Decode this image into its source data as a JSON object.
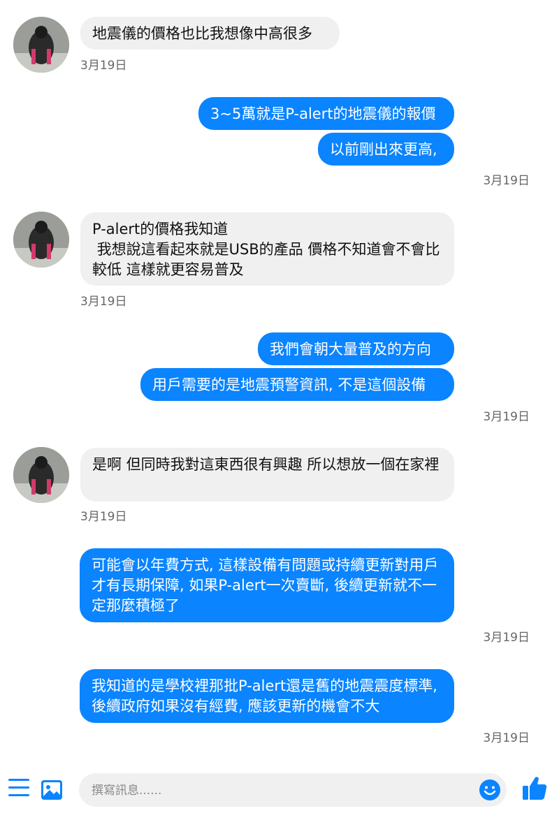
{
  "messages": [
    {
      "sender": "other",
      "text": "地震儀的價格也比我想像中高很多",
      "time": "3月19日"
    },
    {
      "sender": "me",
      "text": "3~5萬就是P-alert的地震儀的報價"
    },
    {
      "sender": "me",
      "text": "以前剛出來更高,",
      "time": "3月19日"
    },
    {
      "sender": "other",
      "text": "P-alert的價格我知道\n 我想說這看起來就是USB的產品 價格不知道會不會比較低 這樣就更容易普及",
      "time": "3月19日"
    },
    {
      "sender": "me",
      "text": "我們會朝大量普及的方向"
    },
    {
      "sender": "me",
      "text": "用戶需要的是地震預警資訊, 不是這個設備",
      "time": "3月19日"
    },
    {
      "sender": "other",
      "text": "是啊 但同時我對這東西很有興趣 所以想放一個在家裡",
      "time": "3月19日"
    },
    {
      "sender": "me",
      "text": "可能會以年費方式, 這樣設備有問題或持續更新對用戶才有長期保障, 如果P-alert一次賣斷, 後續更新就不一定那麼積極了",
      "time": "3月19日"
    },
    {
      "sender": "me",
      "text": "我知道的是學校裡那批P-alert還是舊的地震震度標準, 後續政府如果沒有經費, 應該更新的機會不大",
      "time": "3月19日"
    }
  ],
  "composer": {
    "placeholder": "撰寫訊息......"
  },
  "colors": {
    "accent": "#0a84ff",
    "incoming_bubble": "#f0f0f0",
    "outgoing_text": "#ffffff"
  },
  "icons": [
    "menu-icon",
    "image-icon",
    "emoji-icon",
    "thumbs-up-icon",
    "avatar"
  ]
}
